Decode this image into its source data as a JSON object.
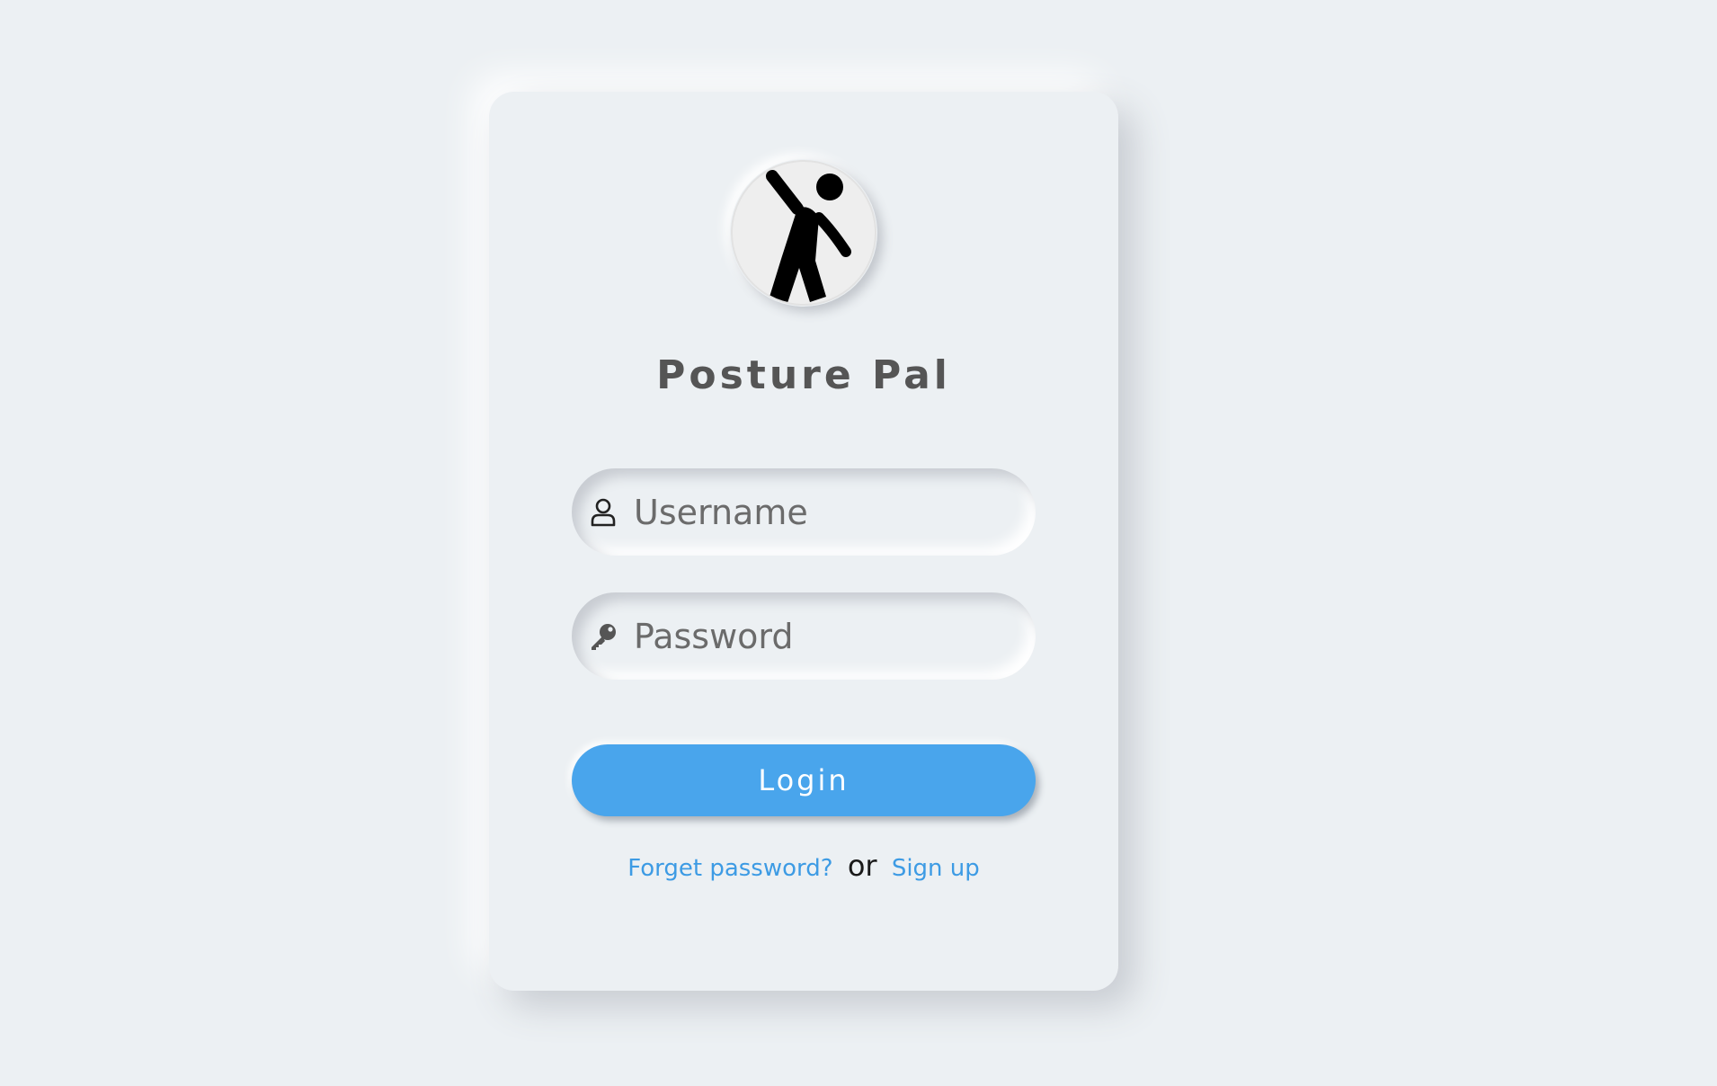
{
  "app": {
    "title": "Posture Pal",
    "logo_icon": "stretching-person-icon"
  },
  "form": {
    "username": {
      "placeholder": "Username",
      "value": "",
      "icon": "user-icon"
    },
    "password": {
      "placeholder": "Password",
      "value": "",
      "icon": "key-icon"
    },
    "login_label": "Login"
  },
  "links": {
    "forgot_password": "Forget password?",
    "or": "or",
    "sign_up": "Sign up"
  },
  "colors": {
    "background": "#ecf0f3",
    "accent": "#49a5ec",
    "link": "#3d9be4",
    "title": "#555555"
  }
}
